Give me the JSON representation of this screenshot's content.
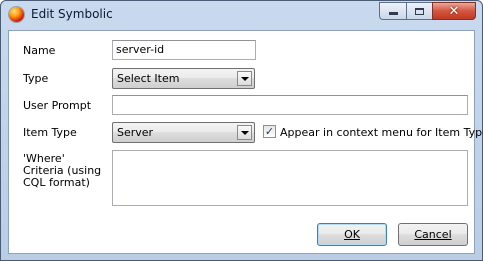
{
  "window": {
    "title": "Edit Symbolic"
  },
  "form": {
    "name": {
      "label": "Name",
      "value": "server-id"
    },
    "type": {
      "label": "Type",
      "selected": "Select Item"
    },
    "user_prompt": {
      "label": "User Prompt",
      "value": ""
    },
    "item_type": {
      "label": "Item Type",
      "selected": "Server"
    },
    "context_menu": {
      "label": "Appear in context menu for Item Type",
      "checked": true
    },
    "where_criteria": {
      "label": "'Where' Criteria (using CQL format)",
      "value": ""
    }
  },
  "buttons": {
    "ok": "OK",
    "cancel": "Cancel"
  },
  "icons": {
    "app": "app-icon",
    "minimize": "minimize-icon",
    "maximize": "maximize-icon",
    "close": "close-icon"
  }
}
